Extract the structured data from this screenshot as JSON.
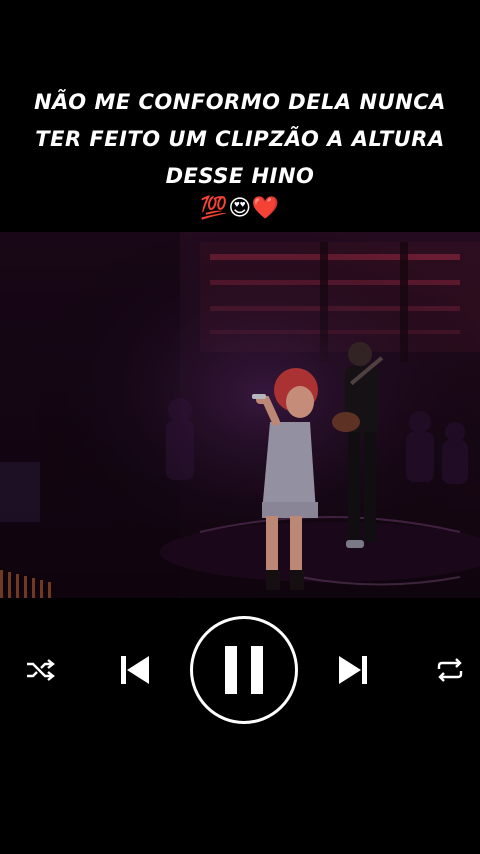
{
  "caption": {
    "line1": "NÃO ME CONFORMO DELA NUNCA",
    "line2": "TER FEITO UM CLIPZÃO A ALTURA",
    "line3": "DESSE HINO",
    "emojis": "💯😍❤️"
  },
  "player": {
    "state": "paused-control-visible",
    "controls": [
      "shuffle",
      "previous",
      "pause",
      "next",
      "repeat"
    ]
  },
  "icons": {
    "shuffle": "shuffle-icon",
    "previous": "skip-previous-icon",
    "pause": "pause-icon",
    "next": "skip-next-icon",
    "repeat": "repeat-icon"
  },
  "colors": {
    "background": "#000000",
    "foreground": "#ffffff"
  }
}
